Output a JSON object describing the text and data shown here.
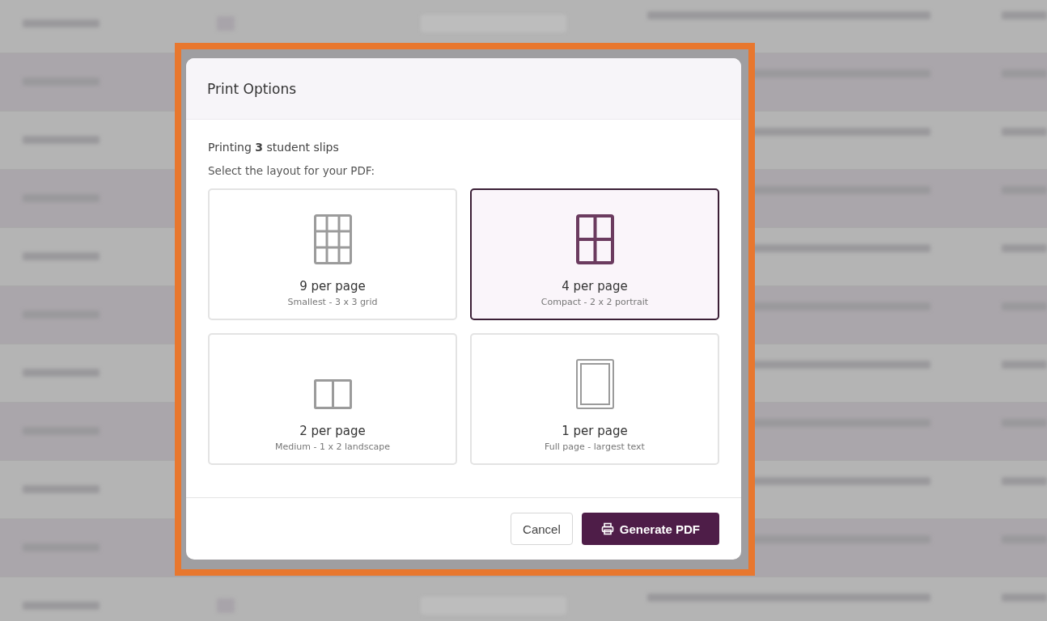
{
  "dialog": {
    "title": "Print Options",
    "summary": "Printing **3** student slips",
    "prompt": "Select the layout for your PDF:",
    "options": [
      {
        "kind": "grid9",
        "label": "9 per page",
        "description": "Smallest - 3 x 3 grid",
        "selected": false
      },
      {
        "kind": "grid4",
        "label": "4 per page",
        "description": "Compact - 2 x 2 portrait",
        "selected": true
      },
      {
        "kind": "grid2",
        "label": "2 per page",
        "description": "Medium - 1 x 2 landscape",
        "selected": false
      },
      {
        "kind": "single",
        "label": "1 per page",
        "description": "Full page - largest text",
        "selected": false
      }
    ],
    "buttons": [
      {
        "kind": "secondary",
        "label": "Cancel"
      },
      {
        "kind": "primary",
        "label": "Generate PDF"
      }
    ]
  }
}
